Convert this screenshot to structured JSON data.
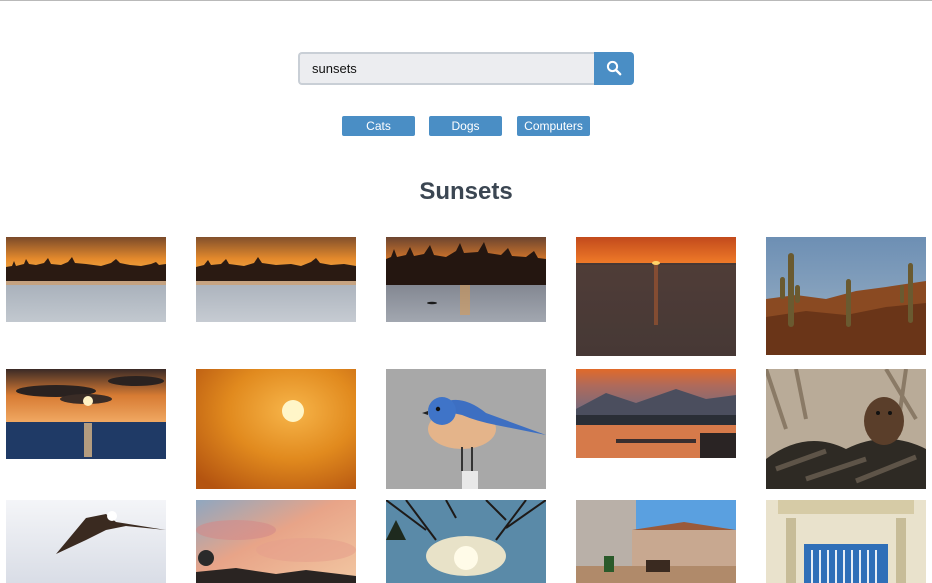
{
  "search": {
    "query": "sunsets"
  },
  "quick_filters": [
    {
      "label": "Cats"
    },
    {
      "label": "Dogs"
    },
    {
      "label": "Computers"
    }
  ],
  "results": {
    "heading": "Sunsets",
    "images": [
      {
        "subject": "sunset over lake with treeline"
      },
      {
        "subject": "sunset over lake with treeline"
      },
      {
        "subject": "sunset over lake with kayaker"
      },
      {
        "subject": "red sunset over sea horizon"
      },
      {
        "subject": "desert cacti at dusk"
      },
      {
        "subject": "sun behind clouds over sea"
      },
      {
        "subject": "orange sun in hazy sky"
      },
      {
        "subject": "bluebird perched on post"
      },
      {
        "subject": "dusk over bay with mountains"
      },
      {
        "subject": "mink on driftwood"
      },
      {
        "subject": "eagle in flight"
      },
      {
        "subject": "pastel clouds with satellite dish"
      },
      {
        "subject": "sun through bare branches"
      },
      {
        "subject": "street with horse carriage"
      },
      {
        "subject": "ornate doorway with blue gate"
      }
    ]
  },
  "colors": {
    "accent": "#4a8ec5",
    "heading": "#3b4652",
    "input_bg": "#ecedf0"
  }
}
